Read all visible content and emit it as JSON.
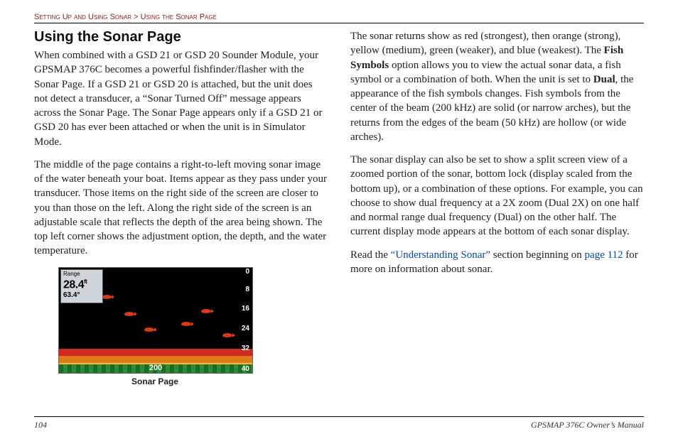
{
  "breadcrumb": {
    "section": "Setting Up and Using Sonar",
    "sep": " > ",
    "page": "Using the Sonar Page"
  },
  "heading": "Using the Sonar Page",
  "left": {
    "p1": "When combined with a GSD 21 or GSD 20 Sounder Module, your GPSMAP 376C becomes a powerful fishfinder/flasher with the Sonar Page. If a GSD 21 or GSD 20 is attached, but the unit does not detect a transducer, a “Sonar Turned Off” message appears across the Sonar Page. The Sonar Page appears only if a GSD 21 or GSD 20 has ever been attached or when the unit is in Simulator Mode.",
    "p2": "The middle of the page contains a right-to-left moving sonar image of the water beneath your boat. Items appear as they pass under your transducer. Those items on the right side of the screen are closer to you than those on the left. Along the right side of the screen is an adjustable scale that reflects the depth of the area being shown. The top left corner shows the adjustment option, the depth, and the water temperature."
  },
  "right": {
    "p1a": "The sonar returns show as red (strongest), then orange (strong), yellow (medium), green (weaker), and blue (weakest). The ",
    "p1b": "Fish Symbols",
    "p1c": " option allows you to view the actual sonar data, a fish symbol or a combination of both. When the unit is set to ",
    "p1d": "Dual",
    "p1e": ", the appearance of the fish symbols changes. Fish symbols from the center of the beam (200 kHz) are solid (or narrow arches), but the returns from the edges of the beam (50 kHz) are hollow (or wide arches).",
    "p2": "The sonar display can also be set to show a split screen view of a zoomed portion of the sonar, bottom lock (display scaled from the bottom up), or a combination of these options. For example, you can choose to show dual frequency at a 2X zoom (Dual 2X) on one half and normal range dual frequency (Dual) on the other half. The current display mode appears at the bottom of each sonar display.",
    "p3a": "Read the ",
    "p3link1": "“Understanding Sonar”",
    "p3b": " section beginning on ",
    "p3link2": "page 112",
    "p3c": " for more on information about sonar."
  },
  "sonar": {
    "label_range": "Range",
    "depth": "28.4",
    "depth_unit": "ft",
    "temp": "63.4°",
    "scale": [
      "0",
      "8",
      "16",
      "24",
      "32",
      "40"
    ],
    "freq": "200",
    "caption": "Sonar Page"
  },
  "footer": {
    "pagenum": "104",
    "manual": "GPSMAP 376C Owner’s Manual"
  }
}
